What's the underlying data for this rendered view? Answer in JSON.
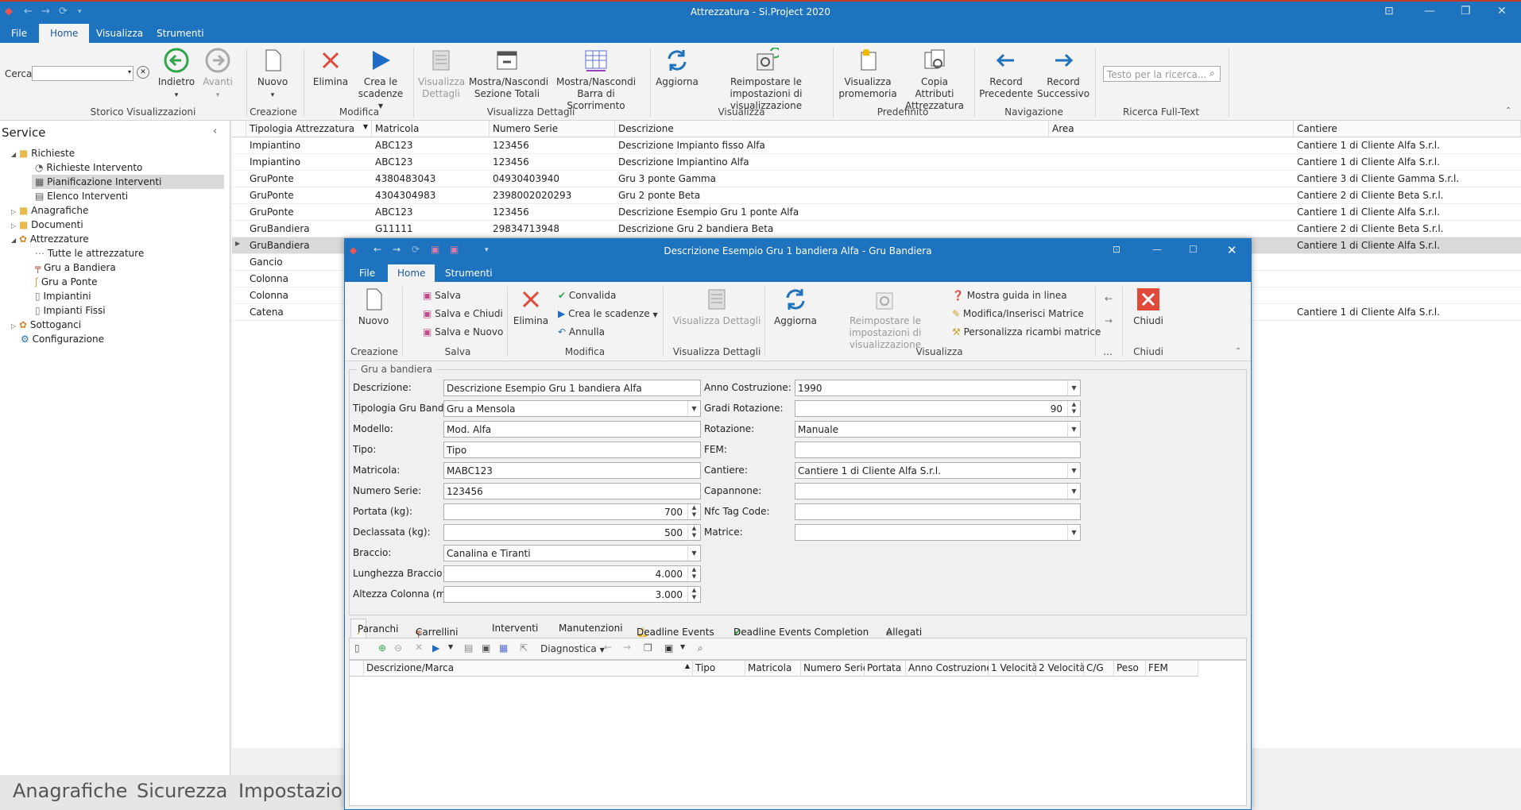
{
  "app": {
    "title": "Attrezzatura - Si.Project 2020",
    "menu": [
      "File",
      "Home",
      "Visualizza",
      "Strumenti"
    ],
    "search_label": "Cerca",
    "ribbon": {
      "indietro": "Indietro",
      "avanti": "Avanti",
      "nuovo": "Nuovo",
      "elimina": "Elimina",
      "crea_scadenze": "Crea le scadenze",
      "visualizza_dettagli": "Visualizza Dettagli",
      "mostra_sezione_totali": "Mostra/Nascondi Sezione Totali",
      "mostra_barra_scorrimento": "Mostra/Nascondi Barra di Scorrimento",
      "aggiorna": "Aggiorna",
      "reimpostare": "Reimpostare le impostazioni di visualizzazione",
      "visualizza_promemoria": "Visualizza promemoria",
      "copia_attributi": "Copia Attributi Attrezzatura",
      "record_precedente": "Record Precedente",
      "record_successivo": "Record Successivo",
      "fulltext_placeholder": "Testo per la ricerca...",
      "groups": {
        "storico": "Storico Visualizzazioni",
        "creazione": "Creazione",
        "modifica": "Modifica",
        "visualizza_dettagli": "Visualizza Dettagli",
        "visualizza": "Visualizza",
        "predefinito": "Predefinito",
        "navigazione": "Navigazione",
        "ricerca": "Ricerca Full-Text"
      }
    }
  },
  "sidebar": {
    "title": "Service",
    "items": [
      "Richieste",
      "Richieste Intervento",
      "Pianificazione Interventi",
      "Elenco Interventi",
      "Anagrafiche",
      "Documenti",
      "Attrezzature",
      "Tutte le attrezzature",
      "Gru a Bandiera",
      "Gru a Ponte",
      "Impiantini",
      "Impianti Fissi",
      "Sottoganci",
      "Configurazione"
    ]
  },
  "grid": {
    "columns": [
      "Tipologia Attrezzatura",
      "Matricola",
      "Numero Serie",
      "Descrizione",
      "Area",
      "Cantiere"
    ],
    "rows": [
      [
        "Impiantino",
        "ABC123",
        "123456",
        "Descrizione Impianto fisso Alfa",
        "",
        "Cantiere 1 di Cliente Alfa S.r.l."
      ],
      [
        "Impiantino",
        "ABC123",
        "123456",
        "Descrizione Impiantino Alfa",
        "",
        "Cantiere 1 di Cliente Alfa S.r.l."
      ],
      [
        "GruPonte",
        "4380483043",
        "04930403940",
        "Gru 3 ponte Gamma",
        "",
        "Cantiere 3 di Cliente Gamma S.r.l."
      ],
      [
        "GruPonte",
        "4304304983",
        "2398002020293",
        "Gru 2 ponte Beta",
        "",
        "Cantiere 2 di Cliente Beta S.r.l."
      ],
      [
        "GruPonte",
        "ABC123",
        "123456",
        "Descrizione Esempio Gru 1 ponte Alfa",
        "",
        "Cantiere 1 di Cliente Alfa S.r.l."
      ],
      [
        "GruBandiera",
        "G11111",
        "29834713948",
        "Descrizione Gru 2 bandiera Beta",
        "",
        "Cantiere 2 di Cliente Beta S.r.l."
      ],
      [
        "GruBandiera",
        "",
        "",
        "",
        "",
        "Cantiere 1 di Cliente Alfa S.r.l."
      ],
      [
        "Gancio",
        "",
        "",
        "",
        "",
        ""
      ],
      [
        "Colonna",
        "",
        "",
        "",
        "",
        ""
      ],
      [
        "Colonna",
        "",
        "",
        "",
        "",
        ""
      ],
      [
        "Catena",
        "",
        "",
        "",
        "",
        "Cantiere 1 di Cliente Alfa S.r.l."
      ]
    ]
  },
  "bottom_nav": [
    "Anagrafiche",
    "Sicurezza",
    "Impostazioni"
  ],
  "dialog": {
    "title": "Descrizione Esempio Gru 1 bandiera Alfa - Gru Bandiera",
    "menu": [
      "File",
      "Home",
      "Strumenti"
    ],
    "ribbon": {
      "nuovo": "Nuovo",
      "salva": "Salva",
      "salva_chiudi": "Salva e Chiudi",
      "salva_nuovo": "Salva e Nuovo",
      "elimina": "Elimina",
      "convalida": "Convalida",
      "crea_scadenze": "Crea le scadenze",
      "annulla": "Annulla",
      "visualizza_dettagli": "Visualizza Dettagli",
      "aggiorna": "Aggiorna",
      "reimpostare": "Reimpostare le impostazioni di visualizzazione",
      "mostra_guida": "Mostra guida in linea",
      "modifica_matrice": "Modifica/Inserisci Matrice",
      "personalizza_ricambi": "Personalizza ricambi matrice",
      "chiudi": "Chiudi",
      "groups": {
        "creazione": "Creazione",
        "salva": "Salva",
        "modifica": "Modifica",
        "visualizza_dettagli": "Visualizza Dettagli",
        "visualizza": "Visualizza",
        "more": "...",
        "chiudi": "Chiudi"
      }
    },
    "form": {
      "group_title": "Gru a bandiera",
      "descrizione_label": "Descrizione:",
      "descrizione": "Descrizione Esempio Gru 1 bandiera Alfa",
      "tipologia_label": "Tipologia Gru Bandiera:",
      "tipologia": "Gru a Mensola",
      "modello_label": "Modello:",
      "modello": "Mod. Alfa",
      "tipo_label": "Tipo:",
      "tipo": "Tipo",
      "matricola_label": "Matricola:",
      "matricola": "MABC123",
      "numero_serie_label": "Numero Serie:",
      "numero_serie": "123456",
      "portata_label": "Portata (kg):",
      "portata": "700",
      "declassata_label": "Declassata (kg):",
      "declassata": "500",
      "braccio_label": "Braccio:",
      "braccio": "Canalina e Tiranti",
      "lunghezza_label": "Lunghezza Braccio (mm):",
      "lunghezza": "4.000",
      "altezza_label": "Altezza Colonna (mm):",
      "altezza": "3.000",
      "anno_label": "Anno Costruzione:",
      "anno": "1990",
      "gradi_label": "Gradi Rotazione:",
      "gradi": "90",
      "rotazione_label": "Rotazione:",
      "rotazione": "Manuale",
      "fem_label": "FEM:",
      "fem": "",
      "cantiere_label": "Cantiere:",
      "cantiere": "Cantiere 1 di Cliente Alfa S.r.l.",
      "capannone_label": "Capannone:",
      "capannone": "",
      "nfc_label": "Nfc Tag Code:",
      "nfc": "",
      "matrice_label": "Matrice:",
      "matrice": ""
    },
    "tabs": [
      "Paranchi",
      "Carrellini",
      "Interventi",
      "Manutenzioni",
      "Deadline Events",
      "Deadline Events Completion",
      "Allegati"
    ],
    "subtoolbar": {
      "diagnostica": "Diagnostica"
    },
    "subgrid_columns": [
      "Descrizione/Marca",
      "Tipo",
      "Matricola",
      "Numero Serie",
      "Portata",
      "Anno Costruzione",
      "1 Velocità",
      "2 Velocità",
      "C/G",
      "Peso",
      "FEM"
    ]
  },
  "colors": {
    "accent": "#1e73be",
    "danger": "#e04a3a",
    "success": "#2fa64a"
  }
}
